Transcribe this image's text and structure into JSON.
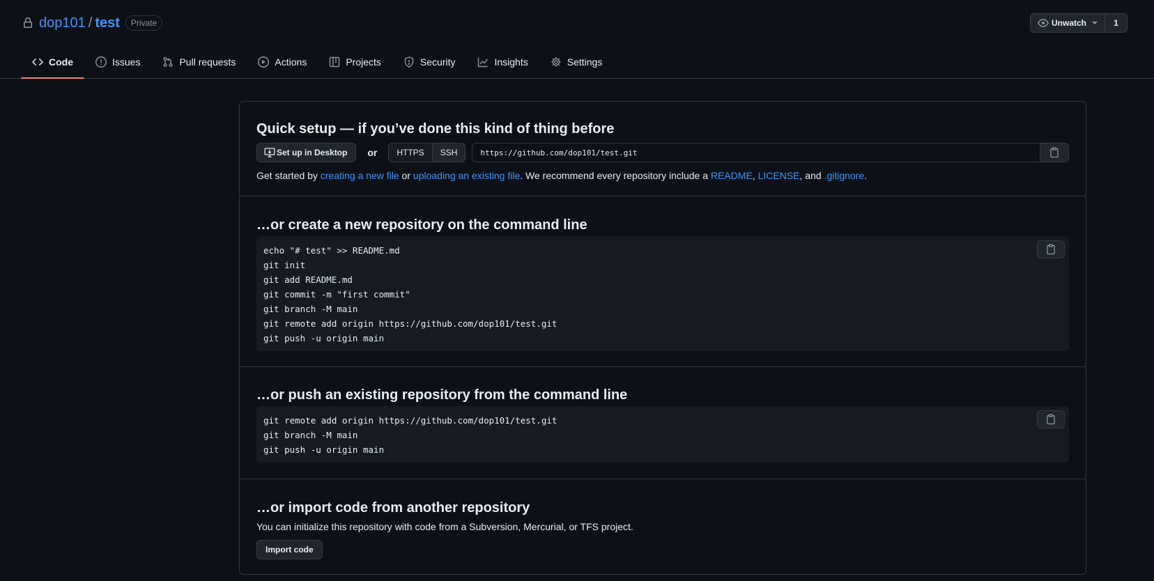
{
  "repo": {
    "owner": "dop101",
    "separator": "/",
    "name": "test",
    "visibility": "Private"
  },
  "watch": {
    "label": "Unwatch",
    "count": "1"
  },
  "nav": {
    "items": [
      {
        "label": "Code",
        "icon": "code-icon",
        "selected": true
      },
      {
        "label": "Issues",
        "icon": "issue-opened-icon"
      },
      {
        "label": "Pull requests",
        "icon": "git-pull-request-icon"
      },
      {
        "label": "Actions",
        "icon": "play-icon"
      },
      {
        "label": "Projects",
        "icon": "table-icon"
      },
      {
        "label": "Security",
        "icon": "shield-icon"
      },
      {
        "label": "Insights",
        "icon": "graph-icon"
      },
      {
        "label": "Settings",
        "icon": "gear-icon"
      }
    ]
  },
  "quick_setup": {
    "title": "Quick setup — if you’ve done this kind of thing before",
    "desktop_button": "Set up in Desktop",
    "or": "or",
    "protocols": [
      "HTTPS",
      "SSH"
    ],
    "selected_protocol": "HTTPS",
    "clone_url": "https://github.com/dop101/test.git",
    "help": {
      "prefix": "Get started by ",
      "link_new_file": "creating a new file",
      "mid1": " or ",
      "link_upload": "uploading an existing file",
      "mid2": ". We recommend every repository include a ",
      "link_readme": "README",
      "comma1": ", ",
      "link_license": "LICENSE",
      "mid3": ", and ",
      "link_gitignore": ".gitignore",
      "suffix": "."
    }
  },
  "create_section": {
    "title": "…or create a new repository on the command line",
    "lines": [
      "echo \"# test\" >> README.md",
      "git init",
      "git add README.md",
      "git commit -m \"first commit\"",
      "git branch -M main",
      "git remote add origin https://github.com/dop101/test.git",
      "git push -u origin main"
    ]
  },
  "push_section": {
    "title": "…or push an existing repository from the command line",
    "lines": [
      "git remote add origin https://github.com/dop101/test.git",
      "git branch -M main",
      "git push -u origin main"
    ]
  },
  "import_section": {
    "title": "…or import code from another repository",
    "description": "You can initialize this repository with code from a Subversion, Mercurial, or TFS project.",
    "button": "Import code"
  },
  "colors": {
    "background": "#0d1117",
    "link": "#4493f8",
    "border": "#30363d",
    "selected_underline": "#f78166"
  }
}
